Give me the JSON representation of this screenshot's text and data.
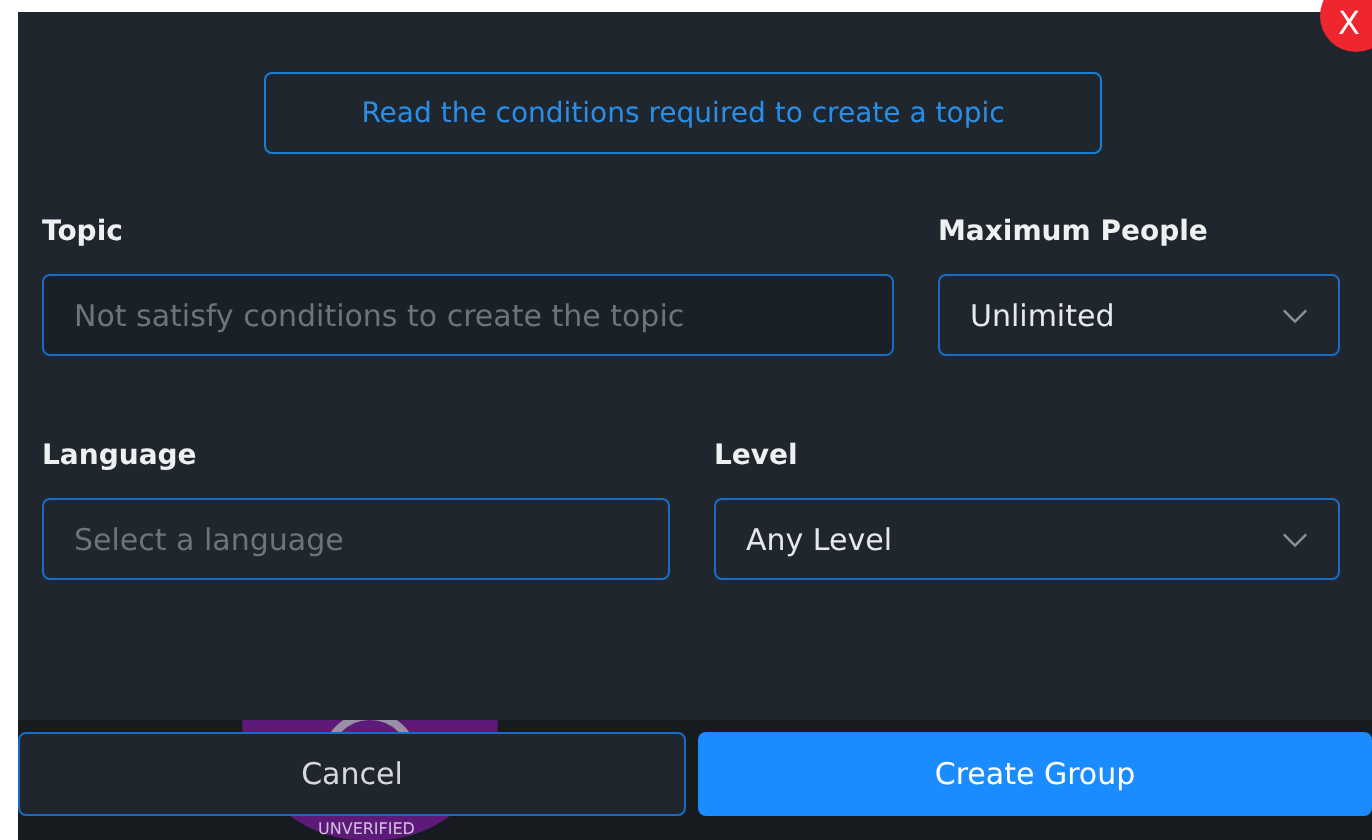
{
  "close_button": {
    "label": "X"
  },
  "conditions_link": {
    "label": "Read the conditions required to create a topic"
  },
  "fields": [
    {
      "kind": "input",
      "label": "Topic",
      "placeholder": "Not satisfy conditions to create the topic"
    },
    {
      "kind": "select",
      "label": "Maximum People",
      "value": "Unlimited"
    },
    {
      "kind": "input",
      "label": "Language",
      "placeholder": "Select a language"
    },
    {
      "kind": "select",
      "label": "Level",
      "value": "Any Level"
    }
  ],
  "background_badge": {
    "label": "UNVERIFIED"
  },
  "buttons": [
    {
      "label": "Cancel",
      "kind": "secondary"
    },
    {
      "label": "Create Group",
      "kind": "primary"
    }
  ]
}
